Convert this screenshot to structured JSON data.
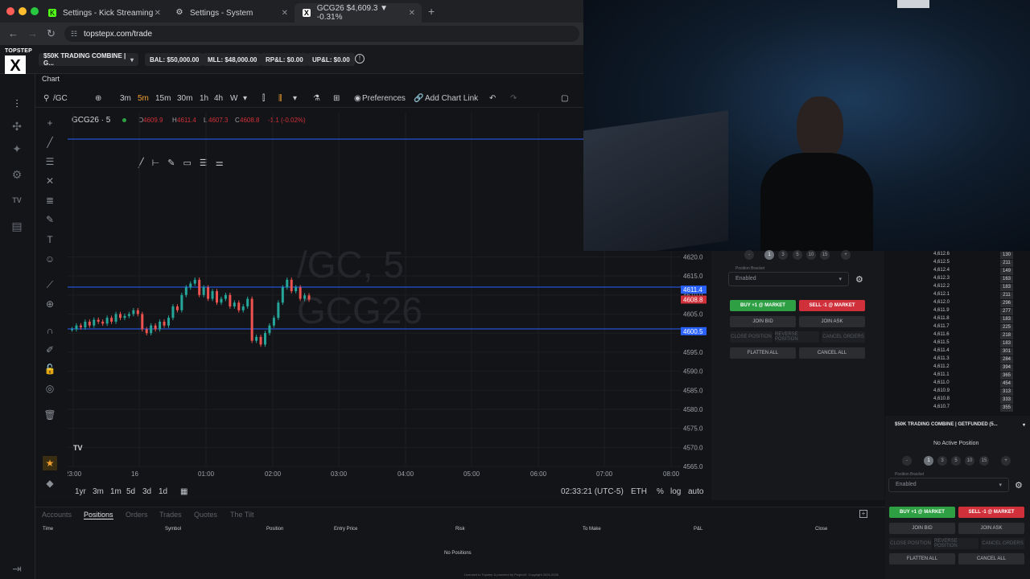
{
  "browser": {
    "tabs": [
      {
        "label": "Settings - Kick Streaming"
      },
      {
        "label": "Settings - System"
      },
      {
        "label": "GCG26 $4,609.3 ▼ -0.31%"
      }
    ],
    "url": "topstepx.com/trade"
  },
  "header": {
    "logo_text": "TOPSTEP",
    "account": "$50K TRADING COMBINE | G...",
    "bal": "BAL: $50,000.00",
    "mll": "MLL: $48,000.00",
    "rpl": "RP&L: $0.00",
    "upl": "UP&L: $0.00"
  },
  "chart_tab": "Chart",
  "toolbar": {
    "symbol": "/GC",
    "timeframes": [
      "3m",
      "5m",
      "15m",
      "30m",
      "1h",
      "4h",
      "W"
    ],
    "preferences": "Preferences",
    "add_chart_link": "Add Chart Link"
  },
  "legend": {
    "symbol": "GCG26 · 5",
    "o": "O",
    "o_val": "4609.9",
    "h": "H",
    "h_val": "4611.4",
    "l": "L",
    "l_val": "4607.3",
    "c": "C",
    "c_val": "4608.8",
    "chg": "-1.1 (-0.02%)"
  },
  "watermark": {
    "line1": "/GC, 5",
    "line2": "GCG26"
  },
  "chart_data": {
    "type": "candlestick",
    "yticks": [
      "4620.0",
      "4615.0",
      "4610.0",
      "4605.0",
      "4600.0",
      "4595.0",
      "4590.0",
      "4585.0",
      "4580.0",
      "4575.0",
      "4570.0",
      "4565.0"
    ],
    "xticks": [
      "23:00",
      "16",
      "01:00",
      "02:00",
      "03:00",
      "04:00",
      "05:00",
      "06:00",
      "07:00",
      "08:00"
    ],
    "price_tags": [
      {
        "label": "4611.4",
        "color": "#2962ff"
      },
      {
        "label": "4608.8",
        "color": "#d0303a"
      },
      {
        "label": "4600.5",
        "color": "#2962ff"
      }
    ],
    "closes": [
      4601,
      4602,
      4601.5,
      4603,
      4602,
      4603.5,
      4603,
      4602.5,
      4604,
      4603,
      4605,
      4604,
      4604.5,
      4605,
      4606,
      4605,
      4601,
      4600,
      4602,
      4601,
      4603,
      4602,
      4604,
      4607,
      4606,
      4610,
      4612,
      4613,
      4614,
      4610,
      4612,
      4609,
      4611,
      4608,
      4609,
      4610,
      4607,
      4608,
      4606,
      4607,
      4609,
      4598,
      4599,
      4597,
      4600,
      4602,
      4604,
      4608,
      4612,
      4614,
      4611,
      4612,
      4609,
      4609.9,
      4608.8
    ],
    "ylim": [
      4565,
      4622
    ]
  },
  "bottom_toolbar": {
    "ranges": [
      "1yr",
      "3m",
      "1m",
      "5d",
      "3d",
      "1d"
    ],
    "time": "02:33:21 (UTC-5)",
    "eth": "ETH",
    "pct": "%",
    "log": "log",
    "auto": "auto"
  },
  "order_panel": {
    "qty": [
      "-",
      "1",
      "3",
      "5",
      "10",
      "15",
      "+"
    ],
    "bracket_label": "Position Bracket",
    "bracket_value": "Enabled",
    "buy": "BUY +1 @ MARKET",
    "sell": "SELL -1 @ MARKET",
    "join_bid": "JOIN BID",
    "join_ask": "JOIN ASK",
    "close_position": "CLOSE POSITION",
    "reverse_position": "REVERSE POSITION",
    "cancel_orders": "CANCEL ORDERS",
    "flatten_all": "FLATTEN ALL",
    "cancel_all": "CANCEL ALL"
  },
  "ladder": [
    {
      "price": "4,612.6",
      "vol": "130"
    },
    {
      "price": "4,612.5",
      "vol": "211"
    },
    {
      "price": "4,612.4",
      "vol": "149"
    },
    {
      "price": "4,612.3",
      "vol": "163"
    },
    {
      "price": "4,612.2",
      "vol": "183"
    },
    {
      "price": "4,612.1",
      "vol": "211"
    },
    {
      "price": "4,612.0",
      "vol": "296"
    },
    {
      "price": "4,611.9",
      "vol": "277"
    },
    {
      "price": "4,611.8",
      "vol": "183"
    },
    {
      "price": "4,611.7",
      "vol": "225"
    },
    {
      "price": "4,611.6",
      "vol": "218"
    },
    {
      "price": "4,611.5",
      "vol": "183"
    },
    {
      "price": "4,611.4",
      "vol": "301"
    },
    {
      "price": "4,611.3",
      "vol": "284"
    },
    {
      "price": "4,611.2",
      "vol": "394"
    },
    {
      "price": "4,611.1",
      "vol": "365"
    },
    {
      "price": "4,611.0",
      "vol": "454"
    },
    {
      "price": "4,610.9",
      "vol": "313"
    },
    {
      "price": "4,610.8",
      "vol": "333"
    },
    {
      "price": "4,610.7",
      "vol": "355"
    }
  ],
  "account_panel": {
    "account": "$50K TRADING COMBINE | GETFUNDED (5...",
    "no_position": "No Active Position"
  },
  "bottom_panel": {
    "tabs": [
      "Accounts",
      "Positions",
      "Orders",
      "Trades",
      "Quotes",
      "The Tilt"
    ],
    "columns": [
      "Time",
      "Symbol",
      "Position",
      "Entry Price",
      "Risk",
      "To Make",
      "P&L",
      "Close"
    ],
    "empty": "No Positions",
    "license": "Licensed to Topstep & powered by ProjectX. Copyright 2024-2026",
    "version": "Version: 1.23.35"
  },
  "colors": {
    "buy": "#2ea043",
    "sell": "#d0303a",
    "line": "#2962ff"
  }
}
